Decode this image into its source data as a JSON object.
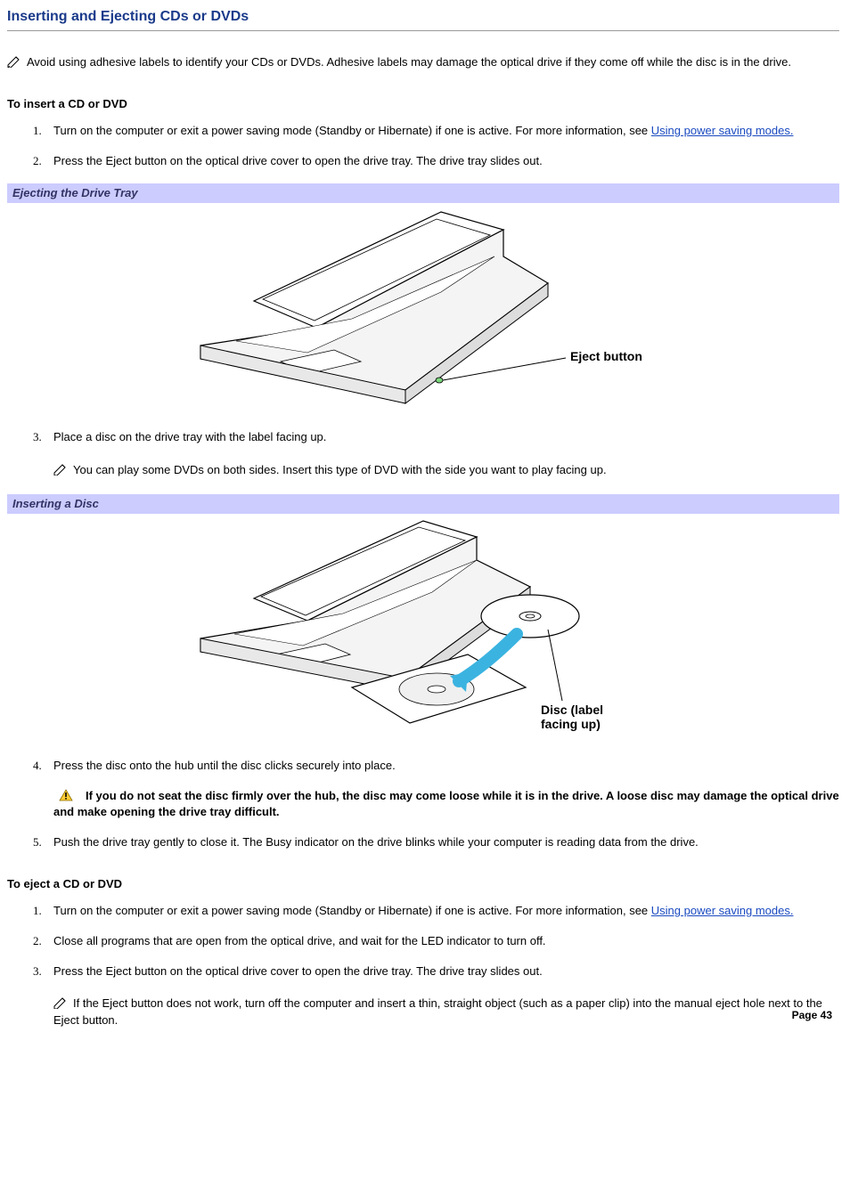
{
  "title": "Inserting and Ejecting CDs or DVDs",
  "intro_note": "Avoid using adhesive labels to identify your CDs or DVDs. Adhesive labels may damage the optical drive if they come off while the disc is in the drive.",
  "insert": {
    "heading": "To insert a CD or DVD",
    "step1_a": "Turn on the computer or exit a power saving mode (Standby or Hibernate) if one is active. For more information, see ",
    "step1_link": "Using power saving modes.",
    "step2": "Press the Eject button on the optical drive cover to open the drive tray. The drive tray slides out.",
    "fig1_caption": "Ejecting the Drive Tray",
    "fig1_callout": "Eject button",
    "step3": "Place a disc on the drive tray with the label facing up.",
    "step3_note": "You can play some DVDs on both sides. Insert this type of DVD with the side you want to play facing up.",
    "fig2_caption": "Inserting a Disc",
    "fig2_callout": "Disc (label facing up)",
    "step4": "Press the disc onto the hub until the disc clicks securely into place.",
    "step4_warning": "If you do not seat the disc firmly over the hub, the disc may come loose while it is in the drive. A loose disc may damage the optical drive and make opening the drive tray difficult.",
    "step5": "Push the drive tray gently to close it. The Busy indicator on the drive blinks while your computer is reading data from the drive."
  },
  "eject": {
    "heading": "To eject a CD or DVD",
    "step1_a": "Turn on the computer or exit a power saving mode (Standby or Hibernate) if one is active. For more information, see ",
    "step1_link": "Using power saving modes.",
    "step2": "Close all programs that are open from the optical drive, and wait for the LED indicator to turn off.",
    "step3": "Press the Eject button on the optical drive cover to open the drive tray. The drive tray slides out.",
    "step3_note": "If the Eject button does not work, turn off the computer and insert a thin, straight object (such as a paper clip) into the manual eject hole next to the Eject button."
  },
  "page_number": "Page 43"
}
